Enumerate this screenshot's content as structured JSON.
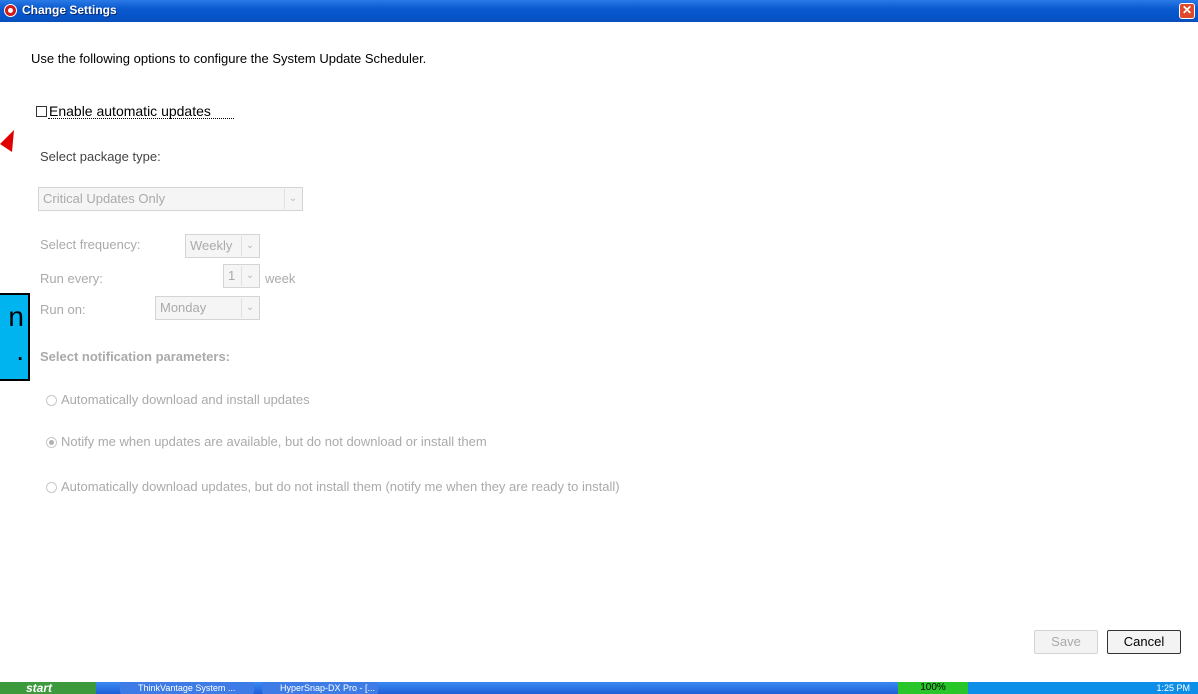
{
  "window": {
    "title": "Change Settings"
  },
  "intro": "Use the following options to configure the System Update Scheduler.",
  "enable_checkbox": {
    "label": "Enable automatic updates",
    "checked": false
  },
  "package_type": {
    "label": "Select package type:",
    "value": "Critical Updates Only"
  },
  "frequency": {
    "label": "Select frequency:",
    "value": "Weekly"
  },
  "run_every": {
    "label": "Run every:",
    "value": "1",
    "unit": "week"
  },
  "run_on": {
    "label": "Run on:",
    "value": "Monday"
  },
  "notification": {
    "heading": "Select notification parameters:",
    "options": [
      {
        "label": "Automatically download and install updates",
        "selected": false
      },
      {
        "label": "Notify me when updates are available, but do not download or install them",
        "selected": true
      },
      {
        "label": "Automatically download updates, but do not install them (notify me when they are ready to install)",
        "selected": false
      }
    ]
  },
  "buttons": {
    "save": "Save",
    "cancel": "Cancel"
  },
  "overlay": {
    "line1": "n",
    "line2": "."
  },
  "taskbar": {
    "start": "start",
    "tasks": [
      "ThinkVantage System ...",
      "HyperSnap-DX Pro - [..."
    ],
    "zoom": "100%",
    "clock": "1:25 PM"
  },
  "colors": {
    "title_bar": "#0653c8",
    "overlay": "#00b4f0",
    "annotation_arrow": "#e00000",
    "disabled_text": "#aaaaaa"
  }
}
